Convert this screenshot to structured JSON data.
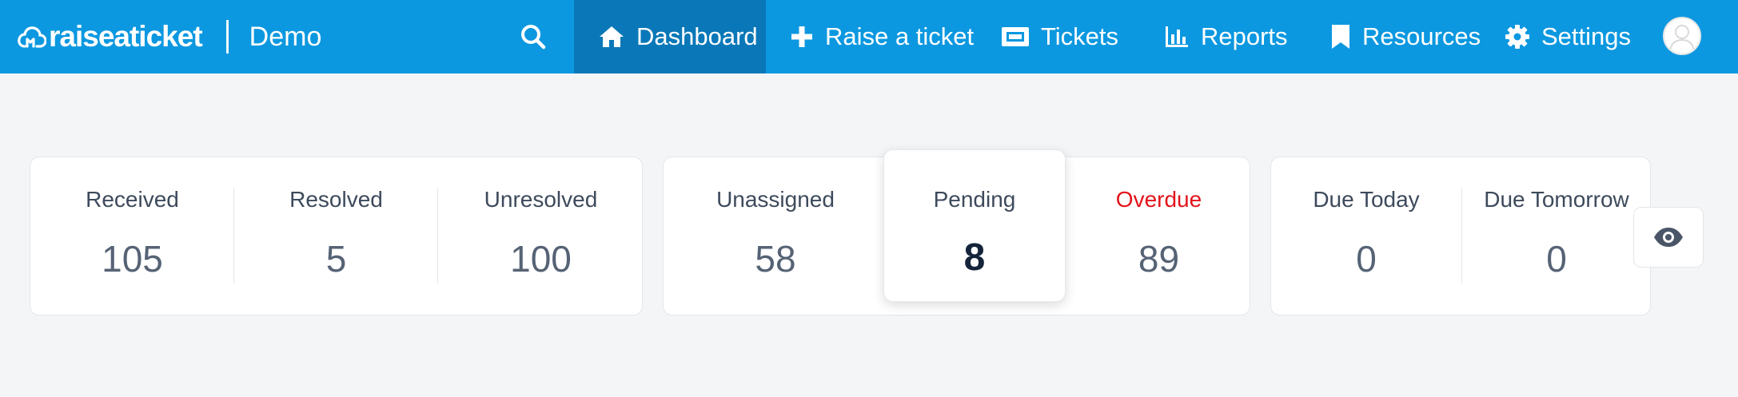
{
  "brand": {
    "logo_text": "raiseaticket",
    "org_name": "Demo"
  },
  "nav": {
    "search_icon": "search-icon",
    "items": [
      {
        "label": "Dashboard",
        "icon": "home-icon",
        "active": true
      },
      {
        "label": "Raise a ticket",
        "icon": "plus-icon",
        "active": false
      },
      {
        "label": "Tickets",
        "icon": "ticket-icon",
        "active": false
      },
      {
        "label": "Reports",
        "icon": "bar-chart-icon",
        "active": false
      },
      {
        "label": "Resources",
        "icon": "bookmark-icon",
        "active": false
      },
      {
        "label": "Settings",
        "icon": "gear-icon",
        "active": false
      }
    ],
    "avatar_icon": "user-avatar-icon"
  },
  "stats": {
    "received": {
      "label": "Received",
      "value": "105"
    },
    "resolved": {
      "label": "Resolved",
      "value": "5"
    },
    "unresolved": {
      "label": "Unresolved",
      "value": "100"
    },
    "unassigned": {
      "label": "Unassigned",
      "value": "58"
    },
    "pending": {
      "label": "Pending",
      "value": "8"
    },
    "overdue": {
      "label": "Overdue",
      "value": "89"
    },
    "due_today": {
      "label": "Due Today",
      "value": "0"
    },
    "due_tomorrow": {
      "label": "Due Tomorrow",
      "value": "0"
    }
  },
  "colors": {
    "topbar": "#0c98e0",
    "active_nav": "#0a78b8",
    "overdue": "#e3131b"
  },
  "toggle_icon": "eye-icon"
}
